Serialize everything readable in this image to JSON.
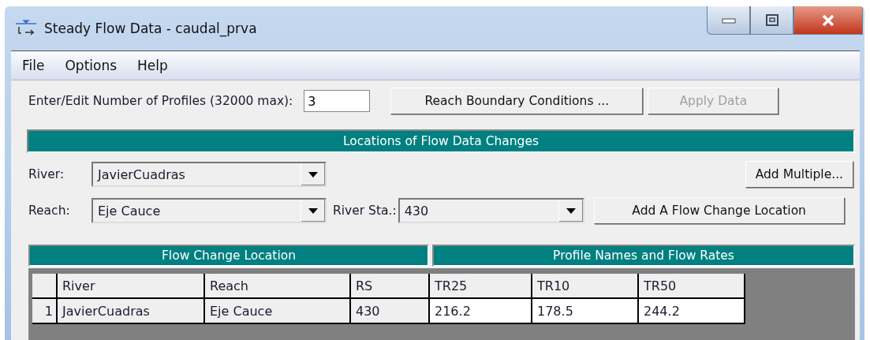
{
  "window": {
    "title": "Steady Flow Data - caudal_prva"
  },
  "menu": [
    "File",
    "Options",
    "Help"
  ],
  "profiles": {
    "label": "Enter/Edit Number of Profiles (32000 max):",
    "value": "3"
  },
  "top_buttons": [
    {
      "label": "Reach Boundary Conditions ...",
      "disabled": false
    },
    {
      "label": "Apply Data",
      "disabled": true
    }
  ],
  "locations_header": "Locations of Flow Data Changes",
  "river": {
    "label": "River:",
    "value": "JavierCuadras"
  },
  "add_multiple": "Add Multiple...",
  "reach": {
    "label": "Reach:",
    "value": "Eje Cauce"
  },
  "river_sta": {
    "label": "River Sta.:",
    "value": "430"
  },
  "add_location": "Add A Flow Change Location",
  "table": {
    "group_headers": [
      "Flow Change Location",
      "Profile Names and Flow Rates"
    ],
    "columns": [
      "River",
      "Reach",
      "RS",
      "TR25",
      "TR10",
      "TR50"
    ],
    "rows": [
      {
        "number": "1",
        "cells": [
          "JavierCuadras",
          "Eje Cauce",
          "430",
          "216.2",
          "178.5",
          "244.2"
        ]
      }
    ]
  }
}
